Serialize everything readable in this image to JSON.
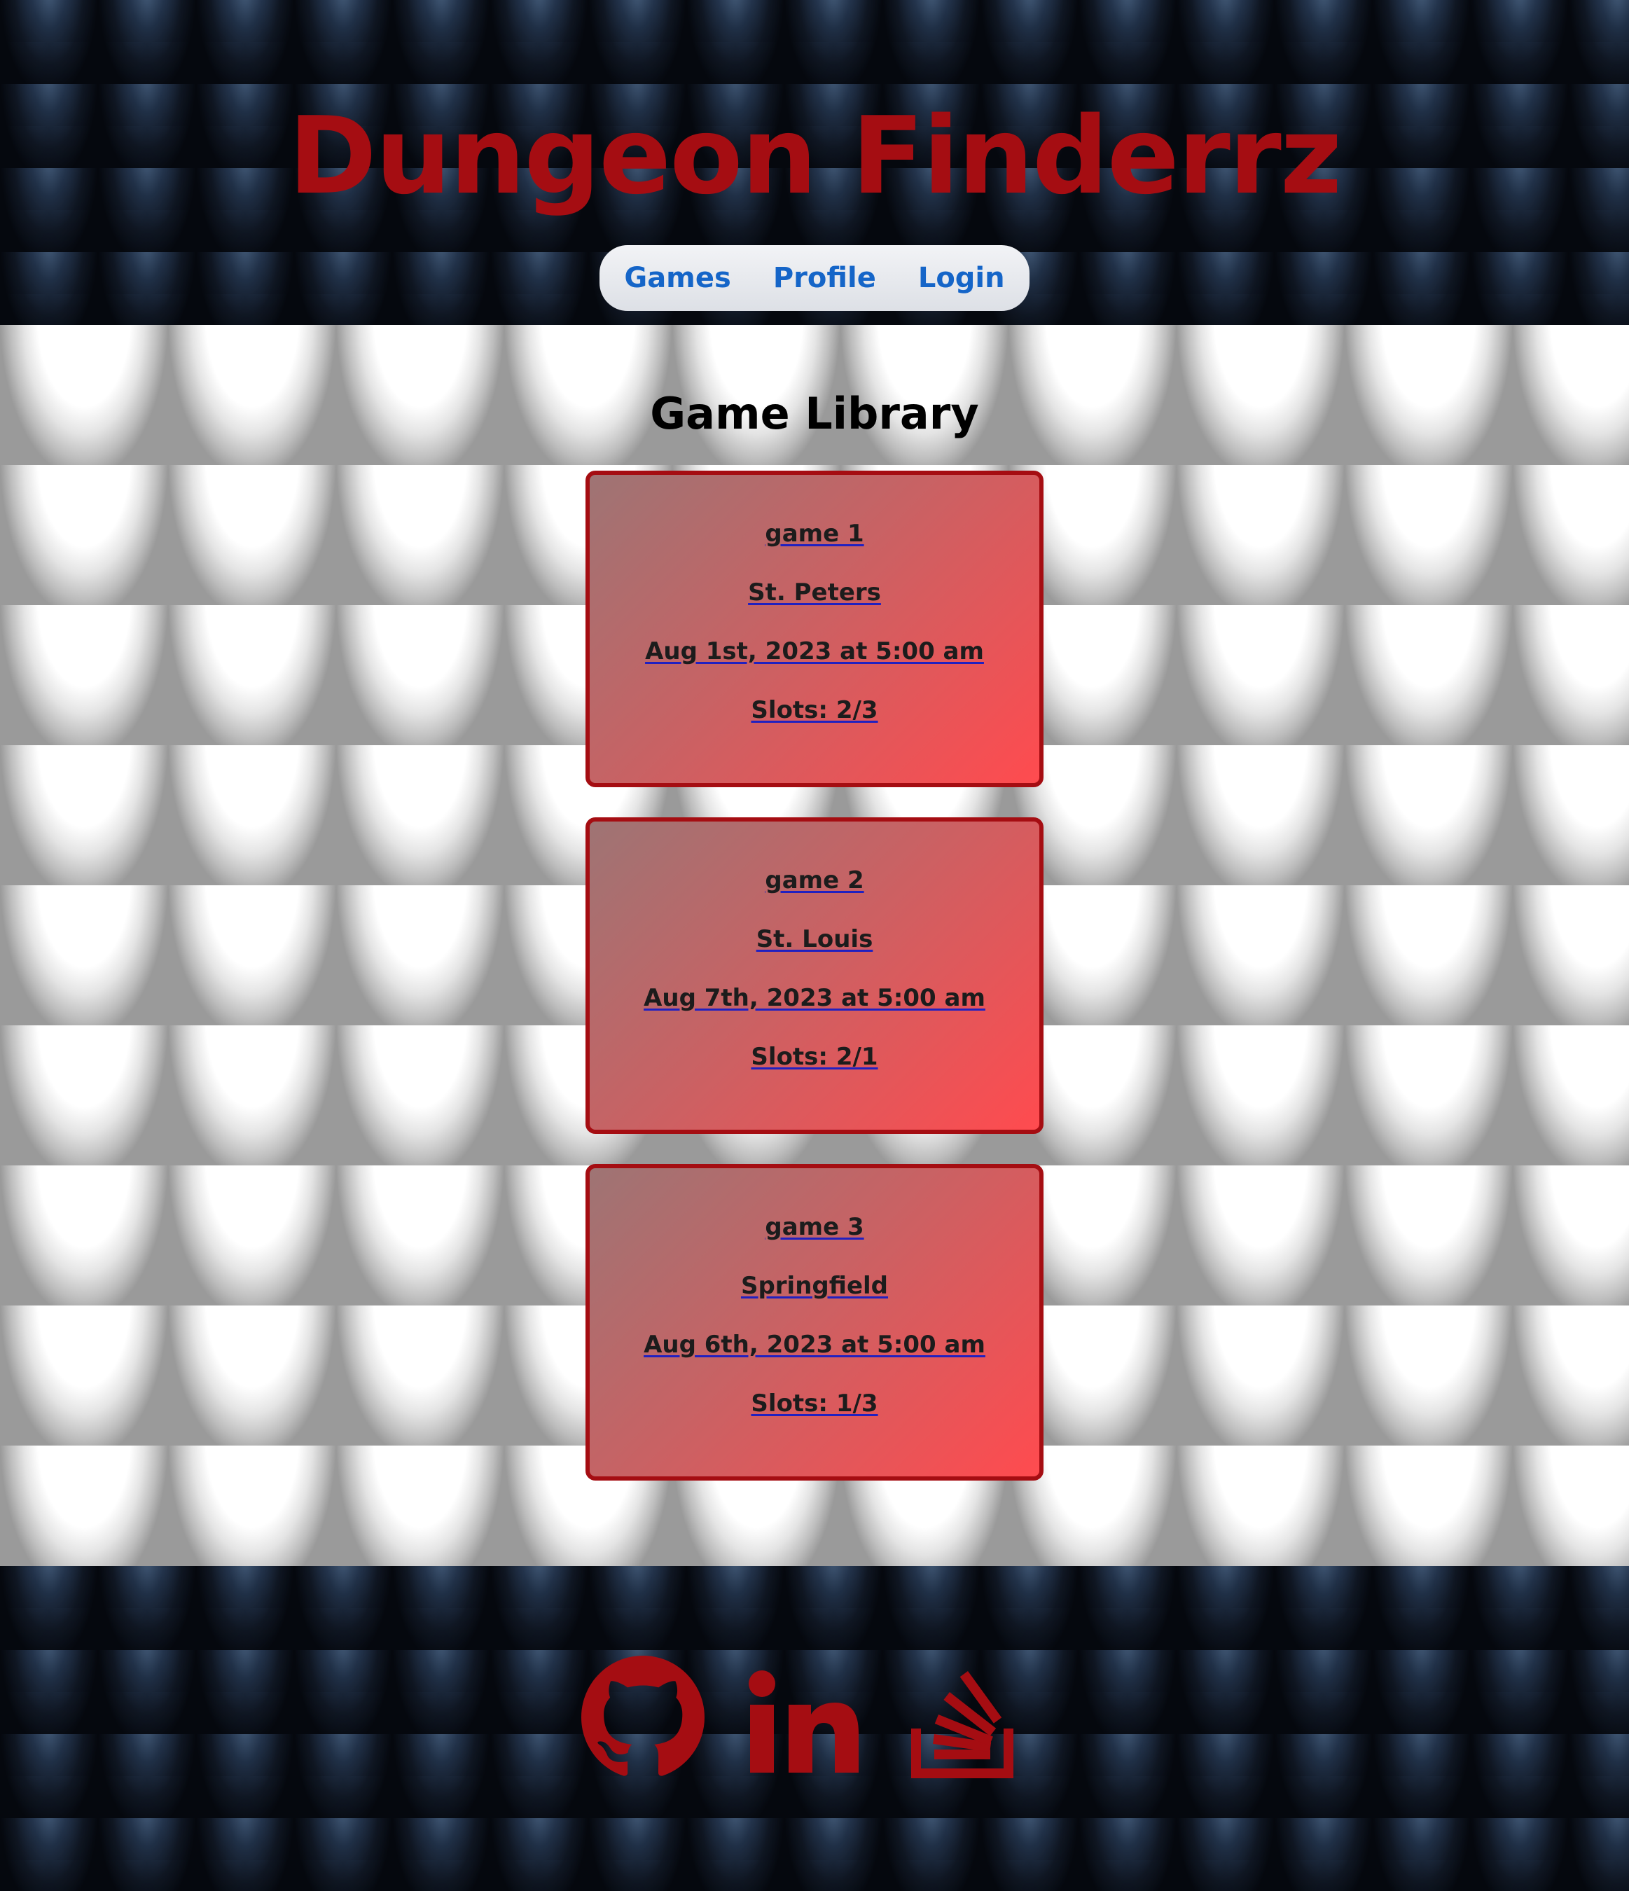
{
  "header": {
    "title": "Dungeon Finderrz",
    "nav": {
      "games": "Games",
      "profile": "Profile",
      "login": "Login"
    }
  },
  "main": {
    "heading": "Game Library",
    "games": [
      {
        "name": "game 1",
        "location": "St. Peters",
        "datetime": "Aug 1st, 2023 at 5:00 am",
        "slots": "Slots: 2/3"
      },
      {
        "name": "game 2",
        "location": "St. Louis",
        "datetime": "Aug 7th, 2023 at 5:00 am",
        "slots": "Slots: 2/1"
      },
      {
        "name": "game 3",
        "location": "Springfield",
        "datetime": "Aug 6th, 2023 at 5:00 am",
        "slots": "Slots: 1/3"
      }
    ]
  },
  "footer": {
    "icons": [
      "github-icon",
      "linkedin-icon",
      "stackoverflow-icon"
    ]
  },
  "colors": {
    "title_red": "#a50d12",
    "nav_blue": "#1565c8",
    "card_border": "#a50d12"
  }
}
